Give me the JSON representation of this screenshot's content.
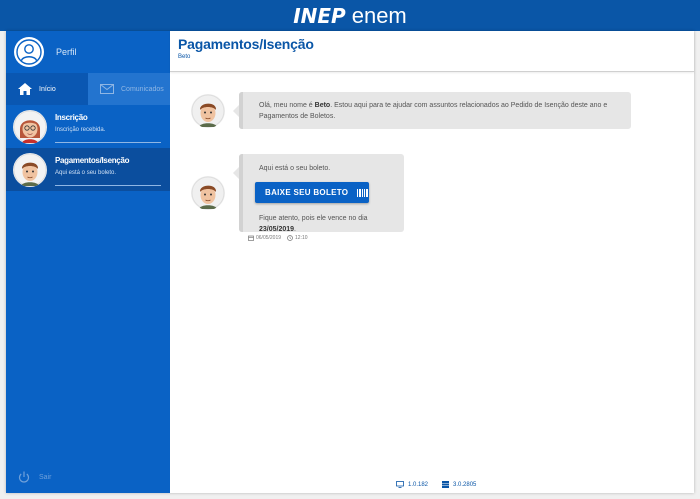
{
  "brand": {
    "logo_inep": "INEP",
    "logo_enem": "enem",
    "bar_color": "#0a56a7"
  },
  "sidebar": {
    "profile_label": "Perfil",
    "tabs": [
      {
        "label": "Início",
        "icon": "home-icon",
        "active": true
      },
      {
        "label": "Comunicados",
        "icon": "mail-icon",
        "active": false
      }
    ],
    "conversations": [
      {
        "title": "Inscrição",
        "subtitle": "Inscrição recebida.",
        "active": false
      },
      {
        "title": "Pagamentos/Isenção",
        "subtitle": "Aqui está o seu boleto.",
        "active": true
      }
    ],
    "logout_label": "Sair"
  },
  "main": {
    "title": "Pagamentos/Isenção",
    "subtitle": "Beto",
    "messages": [
      {
        "pre": "Olá, meu nome é ",
        "name": "Beto",
        "post": ". Estou aqui para te ajudar com assuntos relacionados ao Pedido de Isenção deste ano e Pagamentos de Boletos."
      },
      {
        "intro": "Aqui está o seu boleto.",
        "button_label": "BAIXE SEU BOLETO",
        "warning_pre": "Fique atento, pois ele vence no dia ",
        "due_date": "23/05/2019",
        "warning_post": ".",
        "date": "06/05/2019",
        "time": "12:10"
      }
    ]
  },
  "footer": {
    "version_client": "1.0.182",
    "version_server": "3.0.2805"
  },
  "colors": {
    "sidebar": "#0a62c5",
    "accent": "#0a56a7",
    "bubble": "#e6e6e6"
  }
}
